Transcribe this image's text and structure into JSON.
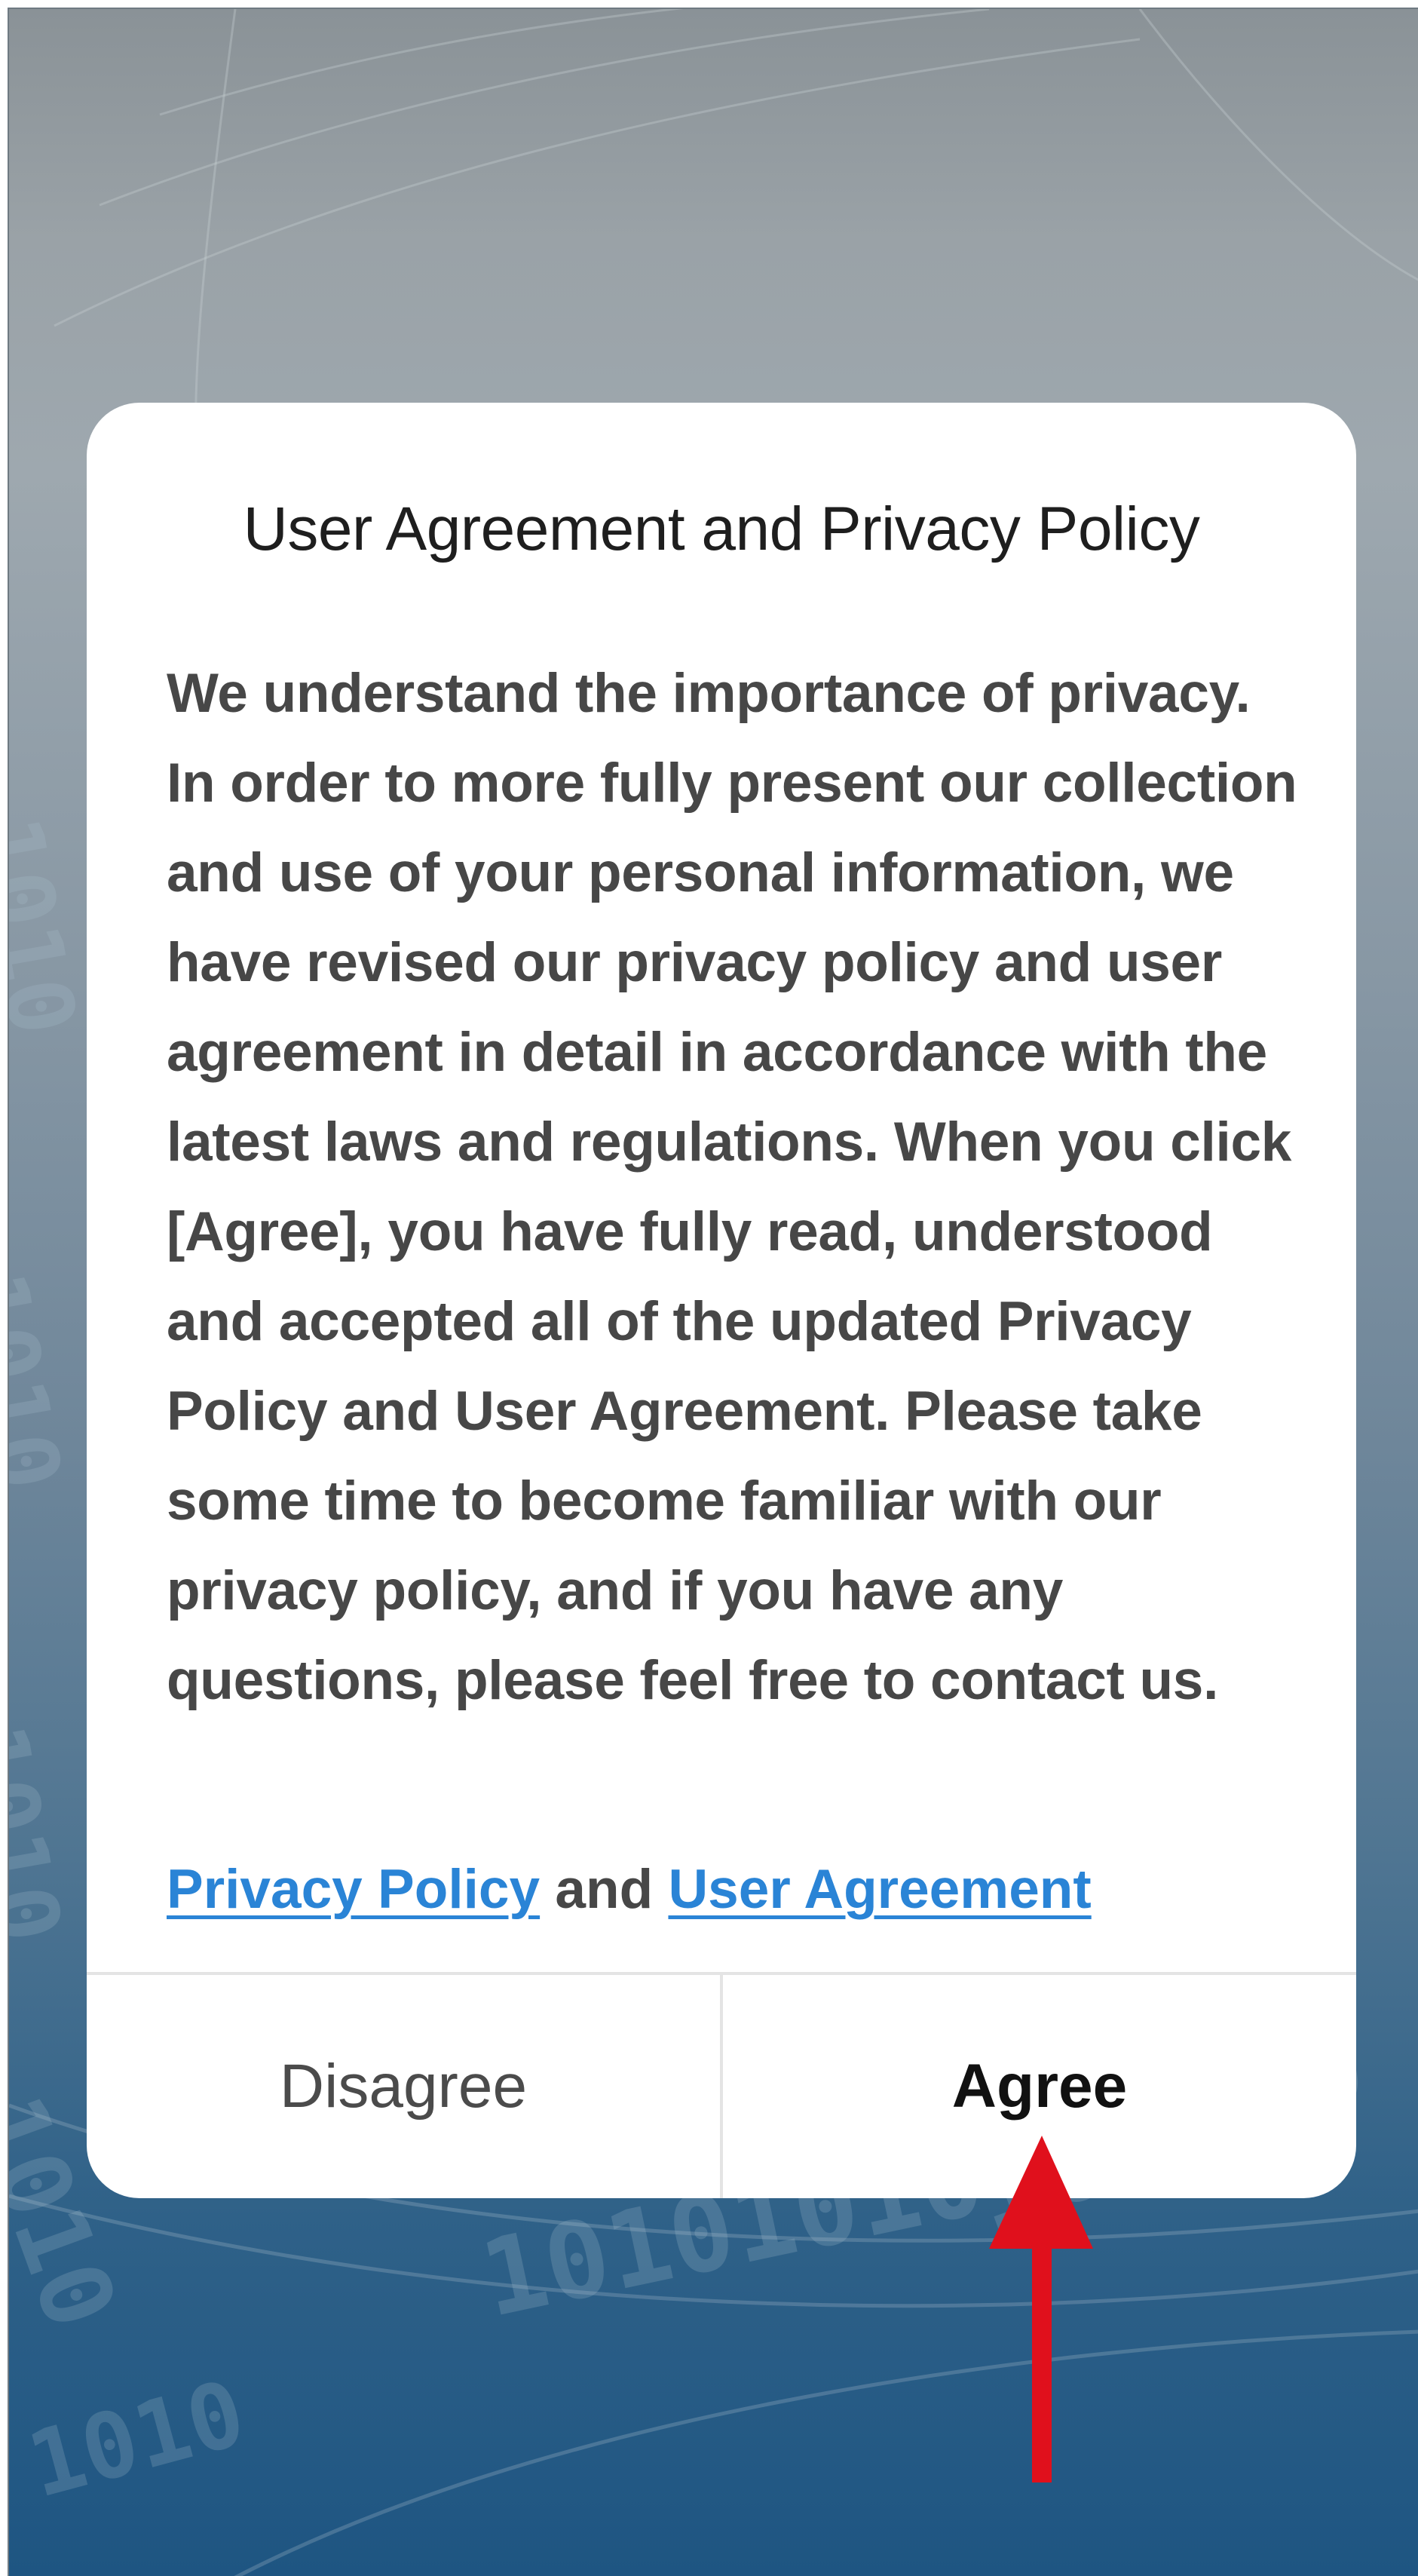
{
  "dialog": {
    "title": "User Agreement and Privacy Policy",
    "body": "We understand the importance of privacy. In order to more fully present our collection and use of your personal information, we have revised our privacy policy and user agreement in detail in accordance with the latest laws and regulations. When you click [Agree], you have fully read, understood and accepted all of the updated Privacy Policy and User Agreement. Please take some time to become familiar with our privacy policy, and if you have any questions, please feel free to contact us.",
    "links": {
      "privacy_policy": "Privacy Policy",
      "joiner": " and ",
      "user_agreement": "User Agreement"
    },
    "buttons": {
      "disagree": "Disagree",
      "agree": "Agree"
    }
  },
  "annotation": {
    "icon": "arrow-up-icon",
    "color": "#e0101c"
  },
  "colors": {
    "link": "#2a84d6",
    "background_top": "#9aa2a7",
    "background_bottom": "#1e5582"
  }
}
